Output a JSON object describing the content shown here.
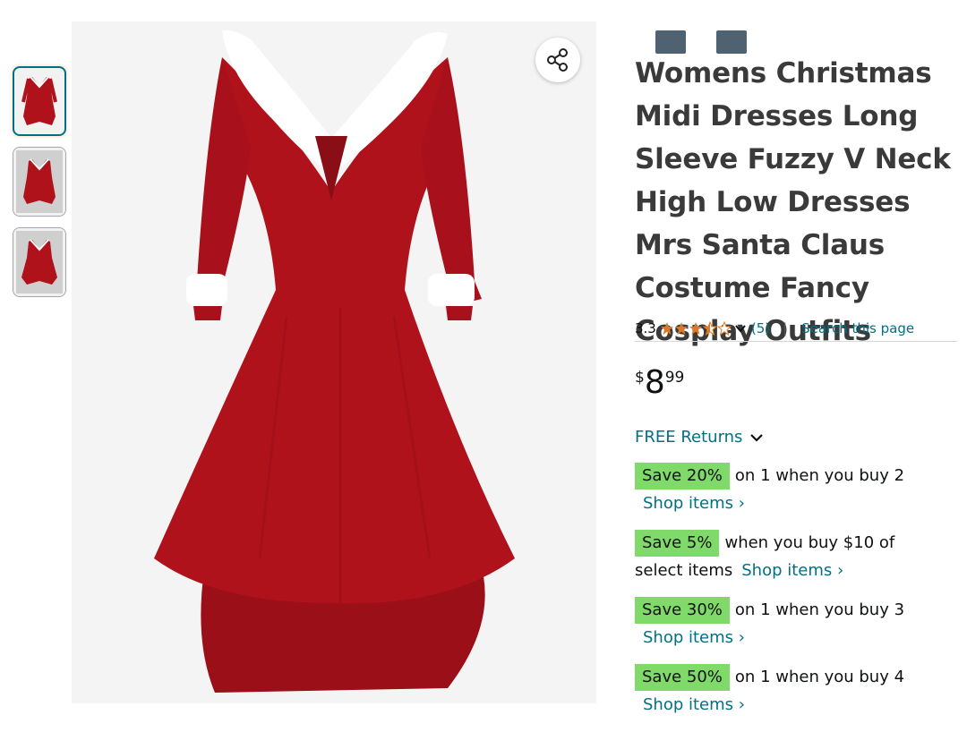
{
  "thumbnails": [
    {
      "name": "thumb-1",
      "active": true
    },
    {
      "name": "thumb-2",
      "active": false
    },
    {
      "name": "thumb-3",
      "active": false
    }
  ],
  "product": {
    "title": "Womens Christmas Midi Dresses Long Sleeve Fuzzy V Neck High Low Dresses Mrs Santa Claus Costume Fancy Cosplay Outfits",
    "rating_value": "3.3",
    "rating_stars": 3.3,
    "rating_count": "(5)",
    "divider": "|",
    "search_link": "Search this page",
    "price_symbol": "$",
    "price_whole": "8",
    "price_fraction": "99",
    "returns_label": "FREE Returns"
  },
  "promotions": [
    {
      "badge": "Save 20%",
      "text": "on 1 when you buy 2",
      "link": "Shop items ›"
    },
    {
      "badge": "Save 5%",
      "text": "when you buy $10 of",
      "text2": "select items",
      "link": "Shop items ›"
    },
    {
      "badge": "Save 30%",
      "text": "on 1 when you buy 3",
      "link": "Shop items ›"
    },
    {
      "badge": "Save 50%",
      "text": "on 1 when you buy 4",
      "link": "Shop items ›"
    }
  ],
  "colors": {
    "dress_red": "#b0121c",
    "fur_white": "#ffffff",
    "link": "#007185",
    "badge_green": "#7fda69",
    "star": "#de7921"
  },
  "icons": {
    "share": "share-icon",
    "chevron": "chevron-down-icon",
    "star": "star-icon"
  }
}
